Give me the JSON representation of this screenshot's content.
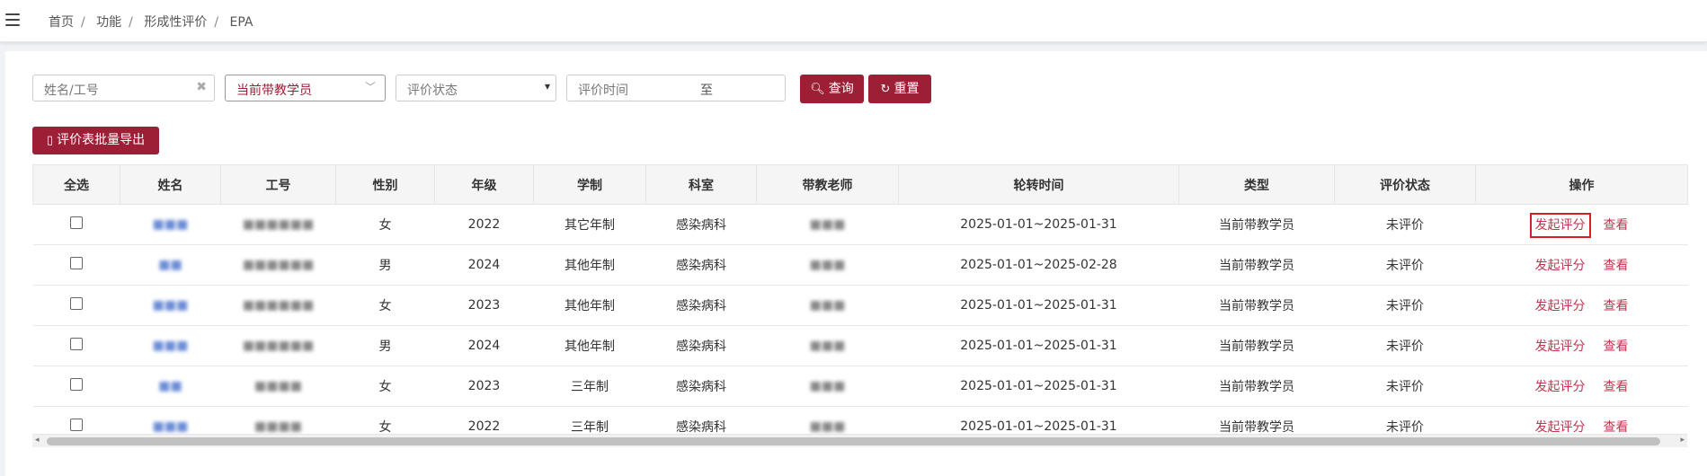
{
  "breadcrumb": [
    "首页",
    "功能",
    "形成性评价",
    "EPA"
  ],
  "filters": {
    "name_placeholder": "姓名/工号",
    "teacher_value": "当前带教学员",
    "status_placeholder": "评价状态",
    "time_placeholder": "评价时间",
    "time_to": "至"
  },
  "buttons": {
    "search": "查询",
    "reset": "重置",
    "export": "评价表批量导出"
  },
  "table": {
    "headers": [
      "全选",
      "姓名",
      "工号",
      "性别",
      "年级",
      "学制",
      "科室",
      "带教老师",
      "轮转时间",
      "类型",
      "评价状态",
      "操作"
    ],
    "rows": [
      {
        "name": "■■■",
        "id": "■■■■■■",
        "gender": "女",
        "grade": "2022",
        "system": "其它年制",
        "dept": "感染病科",
        "teacher": "■■■",
        "time": "2025-01-01~2025-01-31",
        "type": "当前带教学员",
        "status": "未评价",
        "op1": "发起评分",
        "op2": "查看"
      },
      {
        "name": "■■",
        "id": "■■■■■■",
        "gender": "男",
        "grade": "2024",
        "system": "其他年制",
        "dept": "感染病科",
        "teacher": "■■■",
        "time": "2025-01-01~2025-02-28",
        "type": "当前带教学员",
        "status": "未评价",
        "op1": "发起评分",
        "op2": "查看"
      },
      {
        "name": "■■■",
        "id": "■■■■■■",
        "gender": "女",
        "grade": "2023",
        "system": "其他年制",
        "dept": "感染病科",
        "teacher": "■■■",
        "time": "2025-01-01~2025-01-31",
        "type": "当前带教学员",
        "status": "未评价",
        "op1": "发起评分",
        "op2": "查看"
      },
      {
        "name": "■■■",
        "id": "■■■■■■",
        "gender": "男",
        "grade": "2024",
        "system": "其他年制",
        "dept": "感染病科",
        "teacher": "■■■",
        "time": "2025-01-01~2025-01-31",
        "type": "当前带教学员",
        "status": "未评价",
        "op1": "发起评分",
        "op2": "查看"
      },
      {
        "name": "■■",
        "id": "■■■■",
        "gender": "女",
        "grade": "2023",
        "system": "三年制",
        "dept": "感染病科",
        "teacher": "■■■",
        "time": "2025-01-01~2025-01-31",
        "type": "当前带教学员",
        "status": "未评价",
        "op1": "发起评分",
        "op2": "查看"
      },
      {
        "name": "■■■",
        "id": "■■■■",
        "gender": "女",
        "grade": "2022",
        "system": "三年制",
        "dept": "感染病科",
        "teacher": "■■■",
        "time": "2025-01-01~2025-01-31",
        "type": "当前带教学员",
        "status": "未评价",
        "op1": "发起评分",
        "op2": "查看"
      }
    ]
  },
  "colors": {
    "brand": "#9c1f36",
    "highlight": "#d81e28"
  }
}
